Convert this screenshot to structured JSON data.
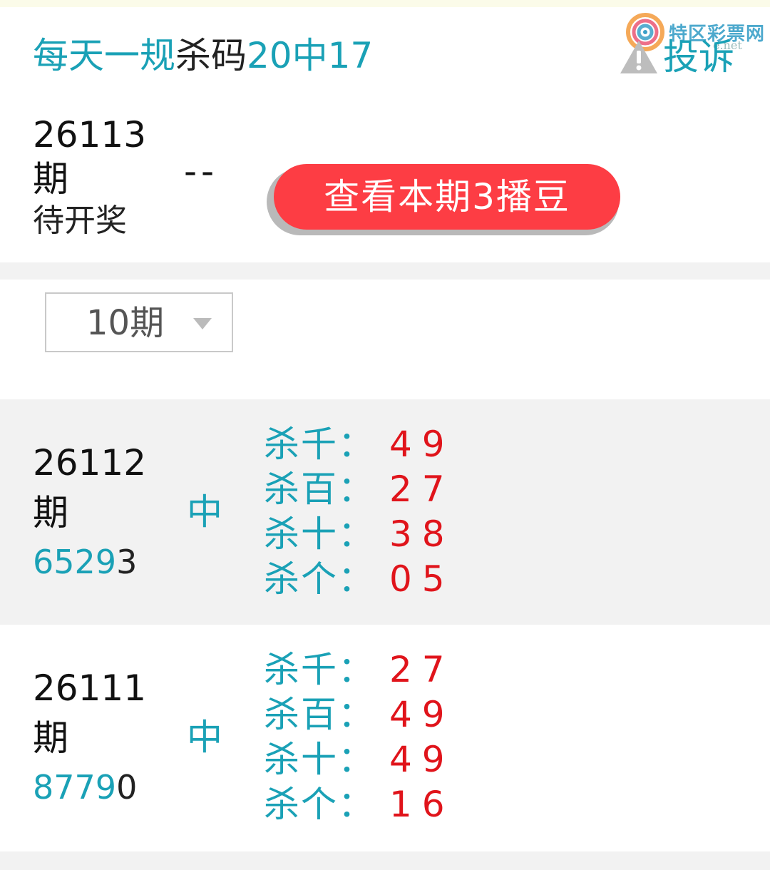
{
  "header": {
    "title_teal_1": "每天一规",
    "title_dark": "杀码",
    "title_teal_2": "20中17",
    "report_label": "投诉",
    "report_icon": "warning-triangle-icon",
    "watermark_logo": "特区彩票网",
    "watermark_sub": "e.net"
  },
  "current": {
    "issue": "26113",
    "suffix": "期",
    "status": "待开奖",
    "dash": "--",
    "button_label": "查看本期3播豆"
  },
  "filter": {
    "selected": "10期"
  },
  "colors": {
    "accent_teal": "#1aa1b6",
    "kill_red": "#e0141b",
    "button_red": "#fd3d44"
  },
  "rows": [
    {
      "issue": "26112",
      "suffix": "期",
      "result_teal": "6529",
      "result_dark": "3",
      "hit": "中",
      "kills": [
        {
          "label": "杀千：",
          "nums": "49"
        },
        {
          "label": "杀百：",
          "nums": "27"
        },
        {
          "label": "杀十：",
          "nums": "38"
        },
        {
          "label": "杀个：",
          "nums": "05"
        }
      ]
    },
    {
      "issue": "26111",
      "suffix": "期",
      "result_teal": "8779",
      "result_dark": "0",
      "hit": "中",
      "kills": [
        {
          "label": "杀千：",
          "nums": "27"
        },
        {
          "label": "杀百：",
          "nums": "49"
        },
        {
          "label": "杀十：",
          "nums": "49"
        },
        {
          "label": "杀个：",
          "nums": "16"
        }
      ]
    }
  ]
}
